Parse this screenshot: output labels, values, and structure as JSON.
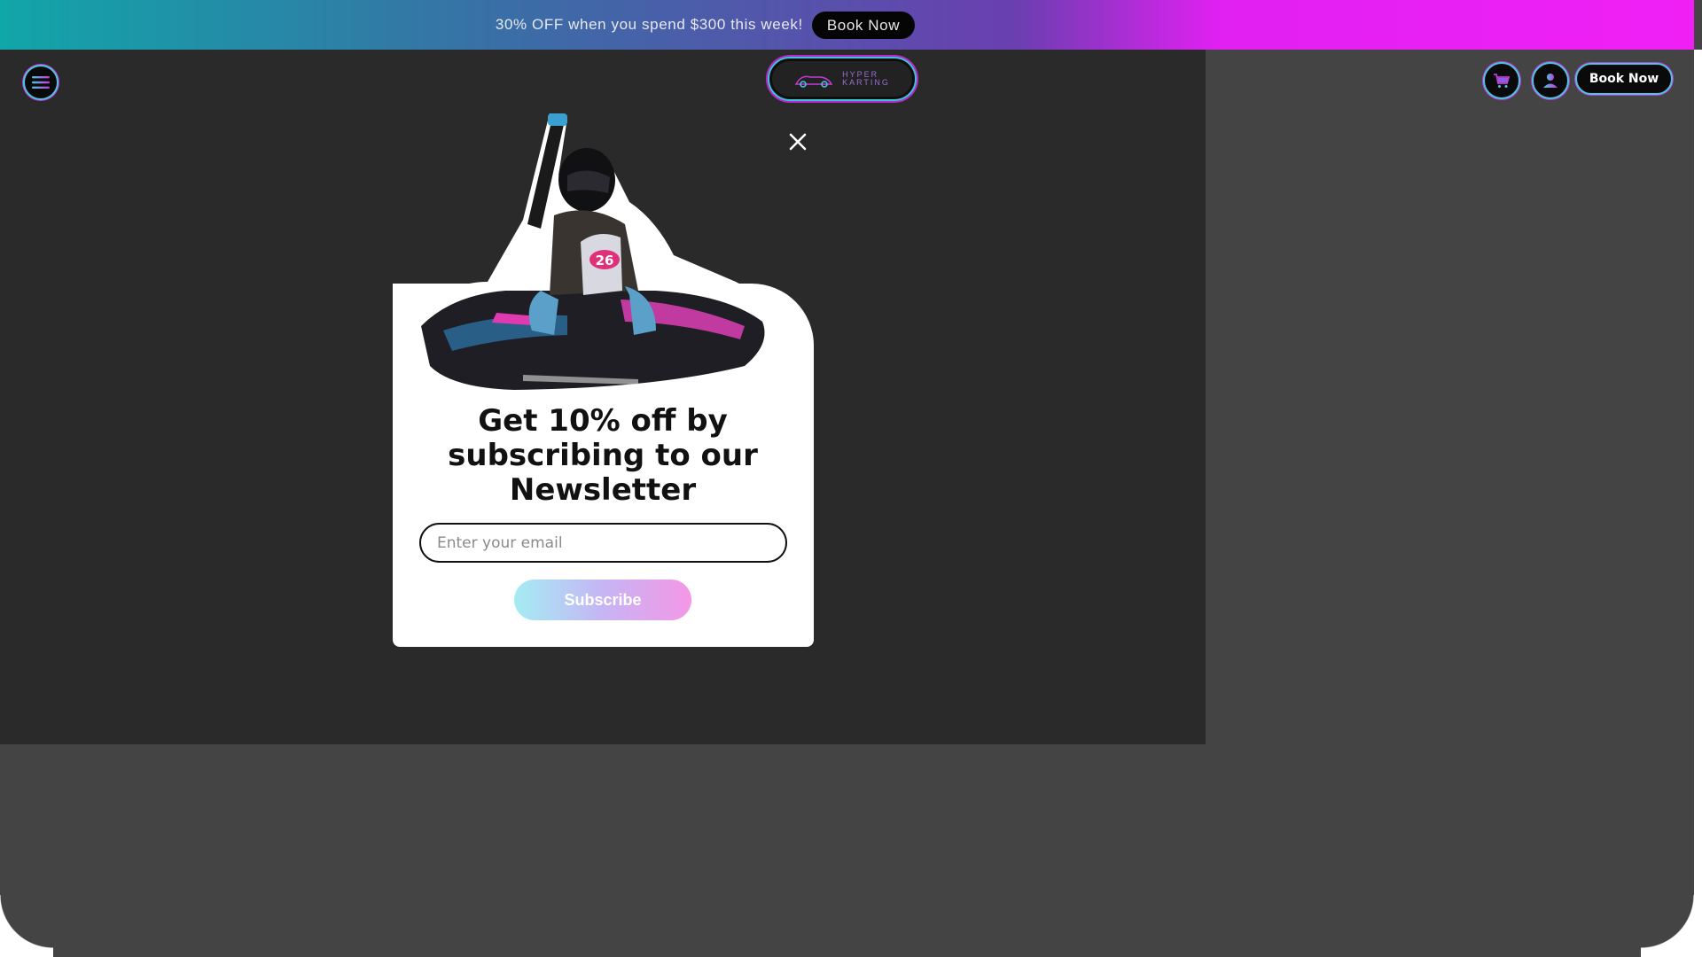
{
  "announcement": {
    "text": "30% OFF when you spend $300 this week!",
    "button_label": "Book Now"
  },
  "header": {
    "logo_line1": "HYPER",
    "logo_line2": "KARTING",
    "menu_icon": "hamburger-menu-icon",
    "cart_icon": "cart-icon",
    "account_icon": "user-icon",
    "book_label": "Book Now"
  },
  "popup": {
    "title": "Get 10% off by subscribing to our Newsletter",
    "email_placeholder": "Enter your email",
    "email_value": "",
    "subscribe_label": "Subscribe",
    "close_icon": "close-icon",
    "kart_number": "26"
  },
  "colors": {
    "accent_cyan": "#4ac6e0",
    "accent_magenta": "#c23ad8",
    "overlay": "#2a2a2a",
    "page_bg": "#444444"
  }
}
